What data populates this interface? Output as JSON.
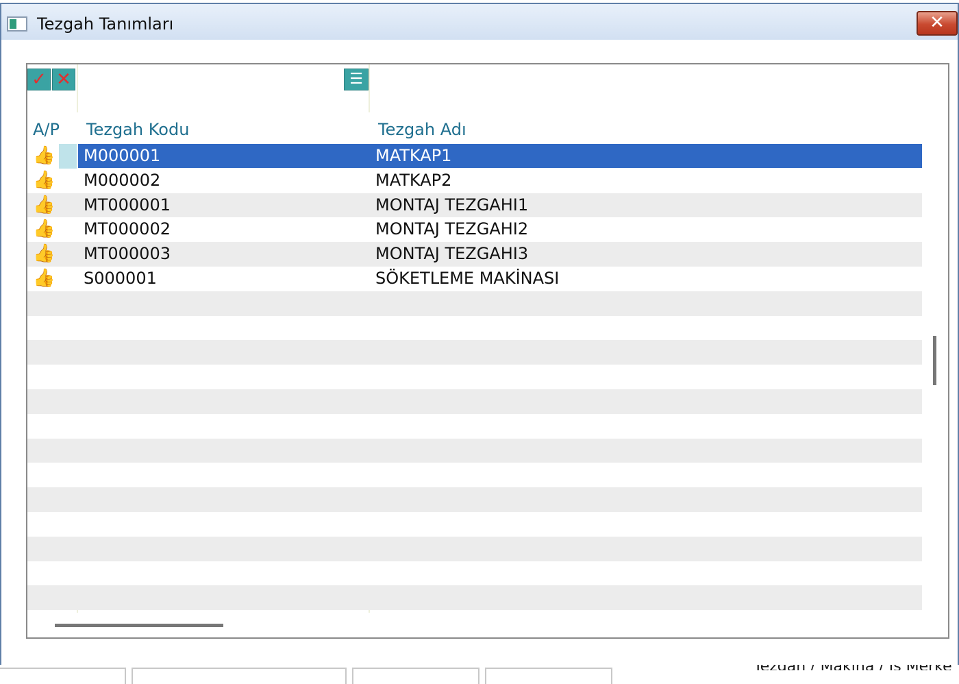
{
  "window": {
    "title": "Tezgah Tanımları",
    "close_label": "✕"
  },
  "toolbar": {
    "select_all_icon": "check-icon",
    "deselect_all_icon": "x-icon",
    "filter_icon": "filter-icon"
  },
  "grid": {
    "columns": [
      "A/P",
      "Tezgah Kodu",
      "Tezgah Adı"
    ],
    "rows": [
      {
        "status_icon": "thumbs-up-icon",
        "code": "M000001",
        "name": "MATKAP1",
        "selected": true
      },
      {
        "status_icon": "thumbs-up-icon",
        "code": "M000002",
        "name": "MATKAP2",
        "selected": false
      },
      {
        "status_icon": "thumbs-up-icon",
        "code": "MT000001",
        "name": "MONTAJ TEZGAHI1",
        "selected": false
      },
      {
        "status_icon": "thumbs-up-icon",
        "code": "MT000002",
        "name": "MONTAJ TEZGAHI2",
        "selected": false
      },
      {
        "status_icon": "thumbs-up-icon",
        "code": "MT000003",
        "name": "MONTAJ TEZGAHI3",
        "selected": false
      },
      {
        "status_icon": "thumbs-up-icon",
        "code": "S000001",
        "name": "SÖKETLEME MAKİNASI",
        "selected": false
      }
    ],
    "empty_rows": 13
  },
  "background_window": {
    "partial_text": "Tezgah / Makina / İş Merke"
  },
  "colors": {
    "selection": "#2f68c4",
    "header_text": "#1f6f8f",
    "toolbar_button": "#3aa3a3",
    "close_button": "#c94a30"
  }
}
